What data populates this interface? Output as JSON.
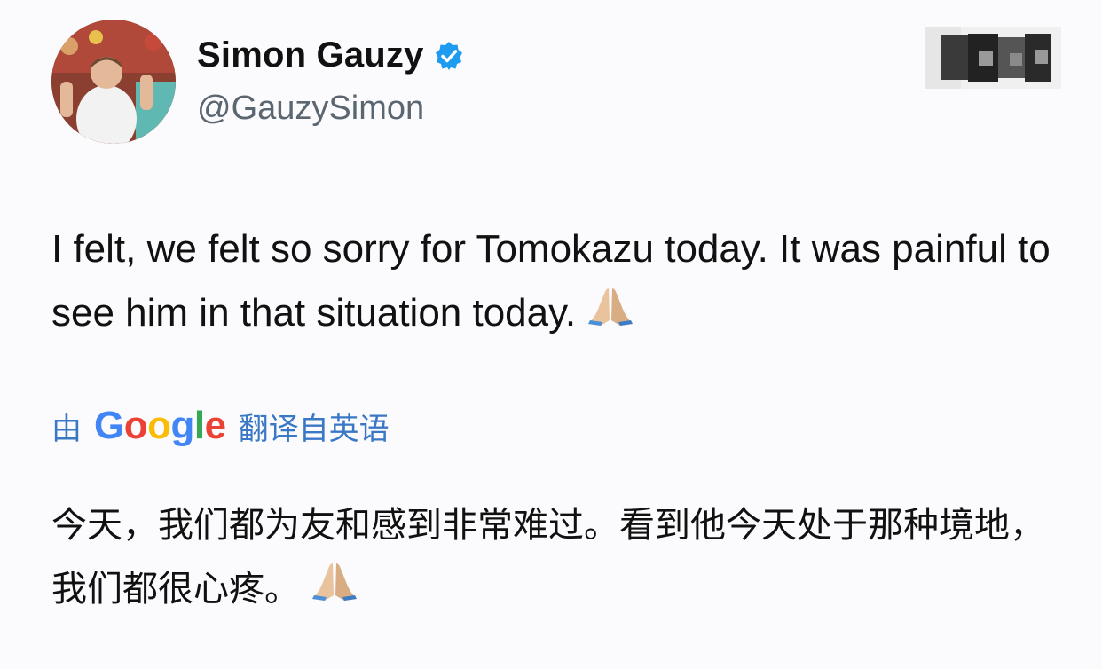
{
  "profile": {
    "display_name": "Simon Gauzy",
    "handle": "@GauzySimon",
    "verified_icon": "verified-badge-icon",
    "avatar_icon": "profile-photo"
  },
  "tweet": {
    "text": "I felt, we felt so sorry for Tomokazu today. It was painful to see him in that situation today.",
    "emoji_icon": "folded-hands-emoji"
  },
  "translation": {
    "prefix": "由",
    "provider_parts": [
      "G",
      "o",
      "o",
      "g",
      "l",
      "e"
    ],
    "suffix": "翻译自英语",
    "text": "今天，我们都为友和感到非常难过。看到他今天处于那种境地，我们都很心疼。",
    "emoji_icon": "folded-hands-emoji"
  },
  "colors": {
    "verified_blue": "#1d9bf0",
    "translate_blue": "#3a78c6",
    "handle_gray": "#5b6670"
  }
}
